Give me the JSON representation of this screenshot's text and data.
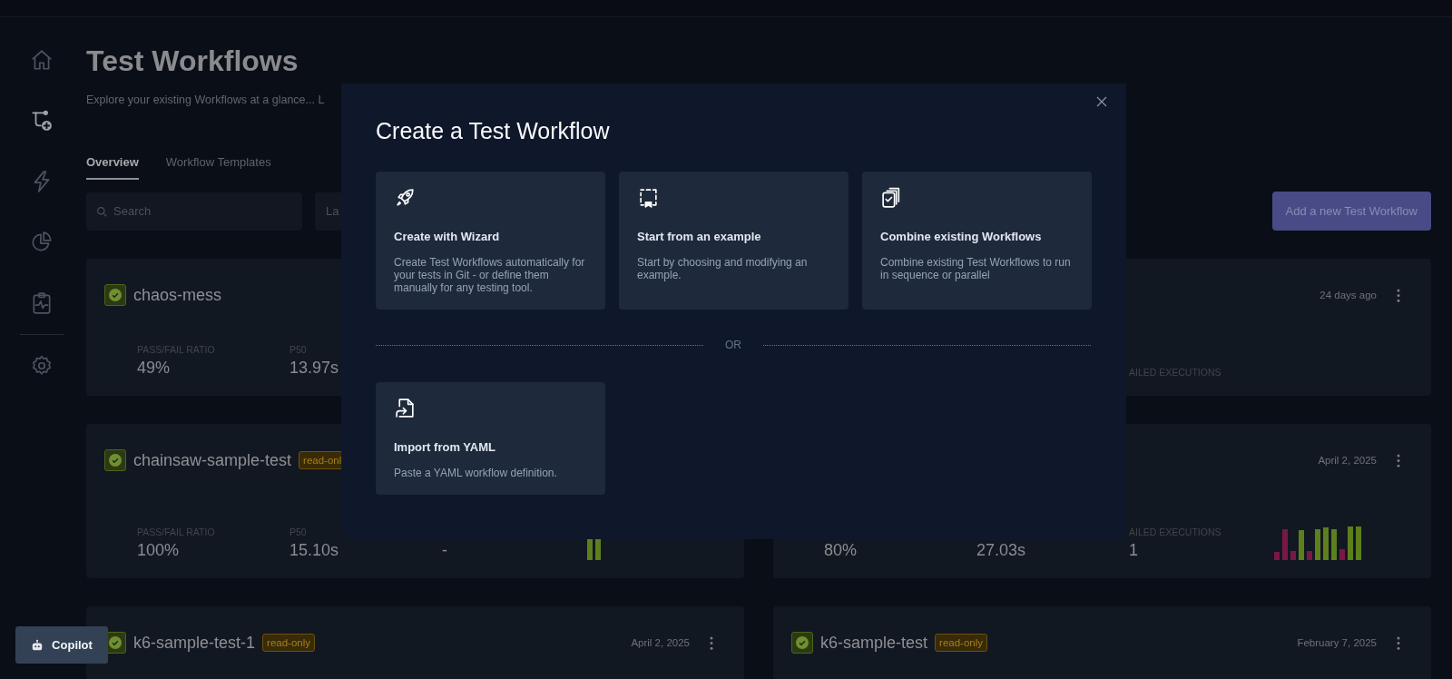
{
  "sidebar": {
    "items": [
      {
        "selected": false
      },
      {
        "selected": true
      },
      {
        "selected": false
      },
      {
        "selected": false
      },
      {
        "selected": false
      },
      {
        "selected": false
      }
    ]
  },
  "page": {
    "title": "Test Workflows",
    "subtitle": "Explore your existing Workflows at a glance... L"
  },
  "tabs": [
    {
      "label": "Overview",
      "selected": true
    },
    {
      "label": "Workflow Templates",
      "selected": false
    }
  ],
  "search": {
    "placeholder": "Search"
  },
  "filter": {
    "placeholder": "La"
  },
  "add_button": "Add a new Test Workflow",
  "workflows": [
    {
      "name": "chaos-mess",
      "passed": true,
      "metrics": [
        {
          "kind": "ratio",
          "label": "PASS/FAIL RATIO",
          "value": "49%"
        },
        {
          "kind": "p50",
          "label": "P50",
          "value": "13.97s"
        }
      ]
    },
    {
      "date": "24 days ago",
      "metrics": [
        {
          "kind": "failed",
          "label": "AILED EXECUTIONS"
        }
      ]
    },
    {
      "name": "chainsaw-sample-test",
      "passed": true,
      "badge": "read-onl",
      "history": true,
      "metrics": [
        {
          "kind": "ratio",
          "label": "PASS/FAIL RATIO",
          "value": "100%"
        },
        {
          "kind": "p50",
          "label": "P50",
          "value": "15.10s"
        },
        {
          "kind": "failed",
          "value": "-"
        }
      ]
    },
    {
      "date": "April 2, 2025",
      "history": true,
      "metrics": [
        {
          "kind": "ratio",
          "value": "80%"
        },
        {
          "kind": "p50",
          "value": "27.03s"
        },
        {
          "kind": "failed",
          "label": "AILED EXECUTIONS",
          "value": "1"
        }
      ]
    },
    {
      "name": "k6-sample-test-1",
      "passed": true,
      "badge": "read-only",
      "date": "April 2, 2025"
    },
    {
      "name": "k6-sample-test",
      "passed": true,
      "badge": "read-only",
      "date": "February 7, 2025"
    }
  ],
  "copilot": "Copilot",
  "modal": {
    "title": "Create a Test Workflow",
    "options": [
      {
        "title": "Create with Wizard",
        "description": "Create Test Workflows automatically for your tests in Git - or define them manually for any testing tool."
      },
      {
        "title": "Start from an example",
        "description": "Start by choosing and modifying an example."
      },
      {
        "title": "Combine existing Workflows",
        "description": "Combine existing Test Workflows to run in sequence or parallel"
      }
    ],
    "divider": "OR",
    "import": {
      "title": "Import from YAML",
      "description": "Paste a YAML workflow definition."
    }
  }
}
